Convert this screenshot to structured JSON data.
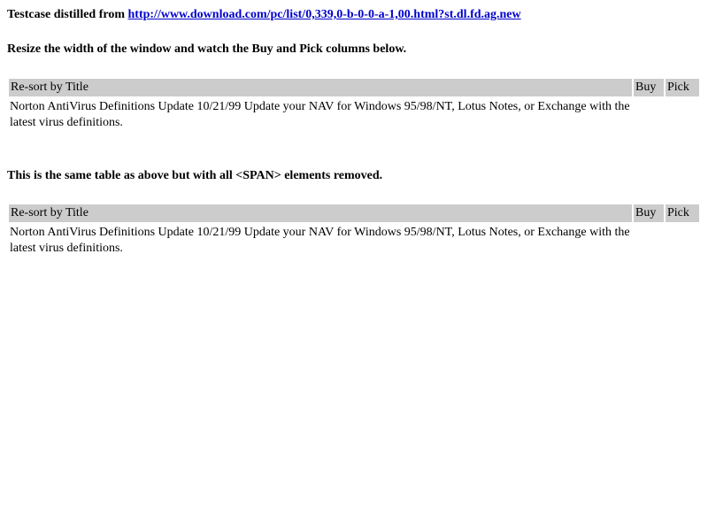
{
  "intro": {
    "prefix": "Testcase distilled from ",
    "link_text": "http://www.download.com/pc/list/0,339,0-b-0-0-a-1,00.html?st.dl.fd.ag.new"
  },
  "instructions": "Resize the width of the window and watch the Buy and Pick columns below.",
  "note": "This is the same table as above but with all <SPAN> elements removed.",
  "tables": [
    {
      "headers": {
        "title": "Re-sort by Title",
        "buy": "Buy",
        "pick": "Pick"
      },
      "row": {
        "description": "Norton AntiVirus Definitions Update 10/21/99 Update your NAV for Windows 95/98/NT, Lotus Notes, or Exchange with the latest virus definitions."
      }
    },
    {
      "headers": {
        "title": "Re-sort by Title",
        "buy": "Buy",
        "pick": "Pick"
      },
      "row": {
        "description": "Norton AntiVirus Definitions Update 10/21/99 Update your NAV for Windows 95/98/NT, Lotus Notes, or Exchange with the latest virus definitions."
      }
    }
  ],
  "colors": {
    "header_bg": "#cccccc",
    "link": "#0000cc"
  }
}
